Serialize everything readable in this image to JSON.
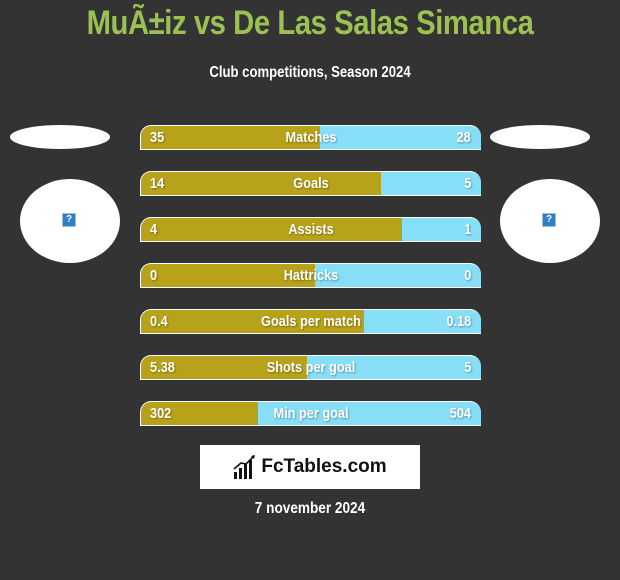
{
  "header": {
    "title": "MuÃ±iz vs De Las Salas Simanca",
    "subtitle": "Club competitions, Season 2024"
  },
  "players": {
    "left": {
      "icon": "unknown-image-icon",
      "icon_glyph": "?"
    },
    "right": {
      "icon": "unknown-image-icon",
      "icon_glyph": "?"
    }
  },
  "colors": {
    "left_bar": "#b8a21a",
    "right_bar": "#87def7",
    "title": "#9bc152",
    "background": "#333333"
  },
  "stats": [
    {
      "label": "Matches",
      "left": "35",
      "right": "28",
      "left_share": 0.525
    },
    {
      "label": "Goals",
      "left": "14",
      "right": "5",
      "left_share": 0.707
    },
    {
      "label": "Assists",
      "left": "4",
      "right": "1",
      "left_share": 0.768
    },
    {
      "label": "Hattricks",
      "left": "0",
      "right": "0",
      "left_share": 0.513
    },
    {
      "label": "Goals per match",
      "left": "0.4",
      "right": "0.18",
      "left_share": 0.657
    },
    {
      "label": "Shots per goal",
      "left": "5.38",
      "right": "5",
      "left_share": 0.487
    },
    {
      "label": "Min per goal",
      "left": "302",
      "right": "504",
      "left_share": 0.343
    }
  ],
  "logo": {
    "text": "FcTables.com",
    "icon": "bar-chart-icon"
  },
  "footer": {
    "date": "7 november 2024"
  }
}
